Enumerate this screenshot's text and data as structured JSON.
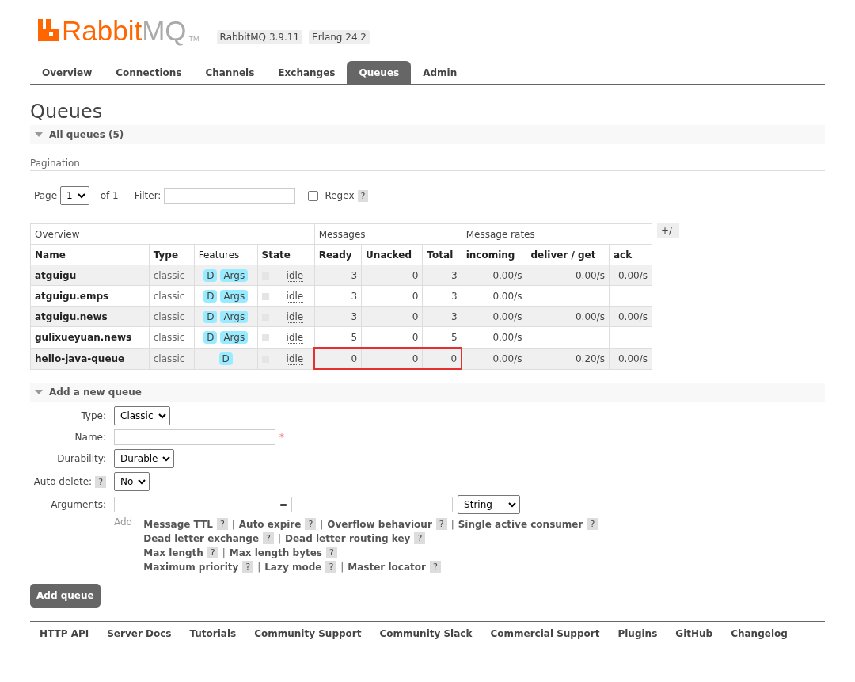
{
  "header": {
    "logo_primary": "Rabbit",
    "logo_secondary": "MQ",
    "logo_tm": "TM",
    "versions": [
      "RabbitMQ 3.9.11",
      "Erlang 24.2"
    ]
  },
  "tabs": [
    {
      "label": "Overview",
      "selected": false
    },
    {
      "label": "Connections",
      "selected": false
    },
    {
      "label": "Channels",
      "selected": false
    },
    {
      "label": "Exchanges",
      "selected": false
    },
    {
      "label": "Queues",
      "selected": true
    },
    {
      "label": "Admin",
      "selected": false
    }
  ],
  "page_title": "Queues",
  "all_queues": {
    "label": "All queues (5)",
    "expanded": true
  },
  "pagination": {
    "label": "Pagination",
    "page_label": "Page",
    "page_value": "1",
    "of_label": "of 1",
    "filter_label": "- Filter:",
    "regex_label": "Regex",
    "regex_checked": false,
    "help": "?"
  },
  "table": {
    "groups": [
      {
        "label": "Overview"
      },
      {
        "label": "Messages"
      },
      {
        "label": "Message rates"
      }
    ],
    "toggle": "+/-",
    "columns": [
      "Name",
      "Type",
      "Features",
      "State",
      "Ready",
      "Unacked",
      "Total",
      "incoming",
      "deliver / get",
      "ack"
    ],
    "rows": [
      {
        "name": "atguigu",
        "type": "classic",
        "features": [
          "D",
          "Args"
        ],
        "state": "idle",
        "ready": "3",
        "unacked": "0",
        "total": "3",
        "incoming": "0.00/s",
        "deliver_get": "0.00/s",
        "ack": "0.00/s",
        "highlighted": false
      },
      {
        "name": "atguigu.emps",
        "type": "classic",
        "features": [
          "D",
          "Args"
        ],
        "state": "idle",
        "ready": "3",
        "unacked": "0",
        "total": "3",
        "incoming": "0.00/s",
        "highlighted": false
      },
      {
        "name": "atguigu.news",
        "type": "classic",
        "features": [
          "D",
          "Args"
        ],
        "state": "idle",
        "ready": "3",
        "unacked": "0",
        "total": "3",
        "incoming": "0.00/s",
        "deliver_get": "0.00/s",
        "ack": "0.00/s",
        "highlighted": false
      },
      {
        "name": "gulixueyuan.news",
        "type": "classic",
        "features": [
          "D",
          "Args"
        ],
        "state": "idle",
        "ready": "5",
        "unacked": "0",
        "total": "5",
        "incoming": "0.00/s",
        "highlighted": false
      },
      {
        "name": "hello-java-queue",
        "type": "classic",
        "features": [
          "D"
        ],
        "state": "idle",
        "ready": "0",
        "unacked": "0",
        "total": "0",
        "incoming": "0.00/s",
        "deliver_get": "0.20/s",
        "ack": "0.00/s",
        "highlighted": true
      }
    ]
  },
  "add_queue": {
    "label": "Add a new queue",
    "expanded": true,
    "type": {
      "label": "Type:",
      "value": "Classic"
    },
    "name": {
      "label": "Name:",
      "required": "*"
    },
    "durability": {
      "label": "Durability:",
      "value": "Durable"
    },
    "auto_delete": {
      "label": "Auto delete:",
      "value": "No",
      "help": "?"
    },
    "arguments": {
      "label": "Arguments:",
      "equals": "=",
      "value_type": "String",
      "add_label": "Add"
    },
    "argument_lines": [
      [
        "Message TTL",
        "Auto expire",
        "Overflow behaviour",
        "Single active consumer"
      ],
      [
        "Dead letter exchange",
        "Dead letter routing key"
      ],
      [
        "Max length",
        "Max length bytes"
      ],
      [
        "Maximum priority",
        "Lazy mode",
        "Master locator"
      ]
    ],
    "help": "?",
    "separator": "|",
    "submit": "Add queue"
  },
  "footer": [
    "HTTP API",
    "Server Docs",
    "Tutorials",
    "Community Support",
    "Community Slack",
    "Commercial Support",
    "Plugins",
    "GitHub",
    "Changelog"
  ]
}
